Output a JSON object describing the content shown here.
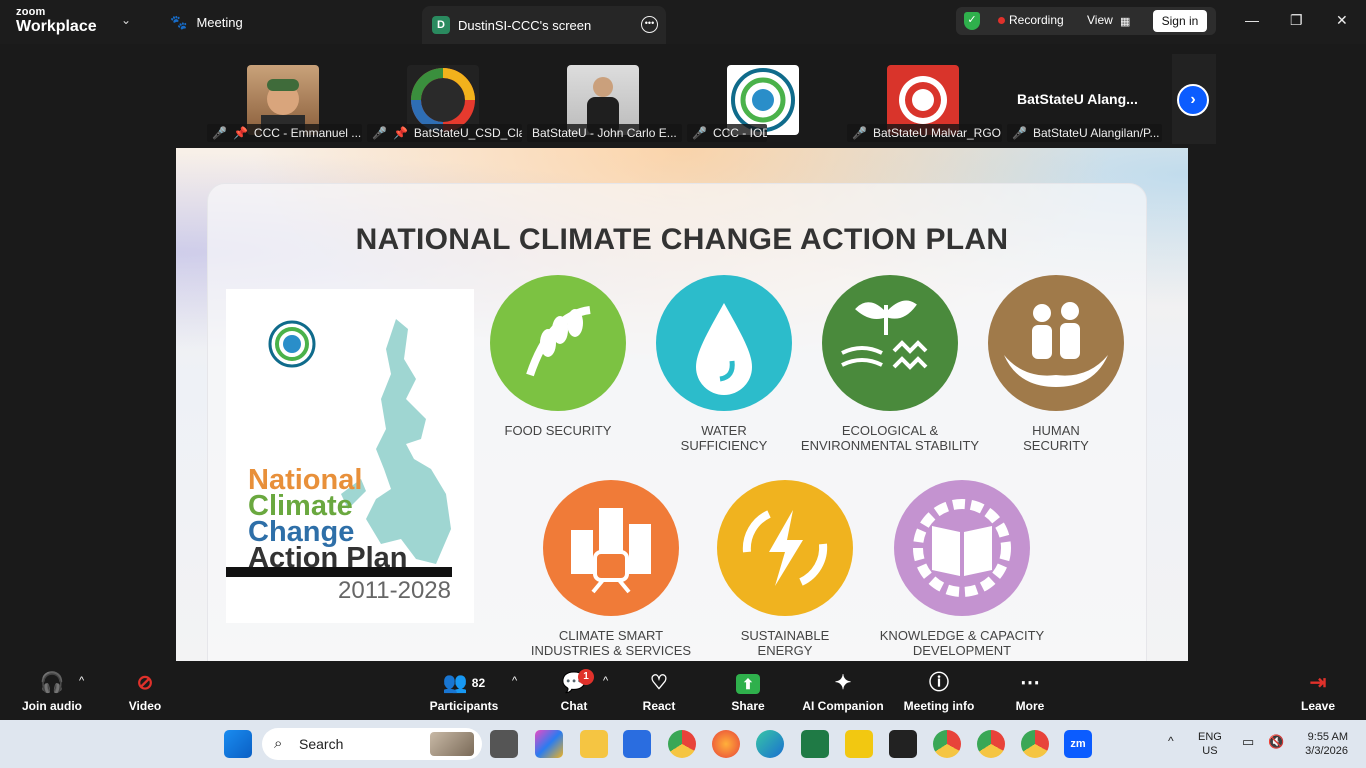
{
  "app": {
    "brand_top": "zoom",
    "brand_bottom": "Workplace"
  },
  "header": {
    "meeting_label": "Meeting",
    "screen_tab_initial": "D",
    "screen_tab_label": "DustinSI-CCC's screen",
    "recording_label": "Recording",
    "view_label": "View",
    "signin_label": "Sign in"
  },
  "participants_strip": [
    {
      "name": "CCC - Emmanuel ...",
      "muted": true,
      "pinned": true
    },
    {
      "name": "BatStateU_CSD_Cla...",
      "muted": true,
      "pinned": true
    },
    {
      "name": "BatStateU - John Carlo E...",
      "muted": false,
      "pinned": false
    },
    {
      "name": "CCC - IOD",
      "muted": true,
      "pinned": false
    },
    {
      "name": "BatStateU Malvar_RGO",
      "muted": true,
      "pinned": false
    },
    {
      "name": "BatStateU Alangilan/P...",
      "muted": true,
      "pinned": false
    }
  ],
  "name_only_tile": "BatStateU  Alang...",
  "slide": {
    "title": "NATIONAL CLIMATE CHANGE ACTION PLAN",
    "cover_lines": [
      "National",
      "Climate",
      "Change",
      "Action Plan"
    ],
    "cover_years": "2011-2028",
    "pillars": [
      {
        "label": "FOOD SECURITY",
        "color": "#7cc242",
        "icon": "rice-icon"
      },
      {
        "label": "WATER\nSUFFICIENCY",
        "color": "#2cbccb",
        "icon": "water-drop-icon"
      },
      {
        "label": "ECOLOGICAL &\nENVIRONMENTAL STABILITY",
        "color": "#4a8a3c",
        "icon": "sprout-wind-icon"
      },
      {
        "label": "HUMAN\nSECURITY",
        "color": "#a07a4a",
        "icon": "family-hands-icon"
      },
      {
        "label": "CLIMATE SMART\nINDUSTRIES & SERVICES",
        "color": "#f07b38",
        "icon": "city-train-icon"
      },
      {
        "label": "SUSTAINABLE\nENERGY",
        "color": "#f0b31f",
        "icon": "lightning-cycle-icon"
      },
      {
        "label": "KNOWLEDGE & CAPACITY\nDEVELOPMENT",
        "color": "#c493d0",
        "icon": "book-gear-icon"
      }
    ]
  },
  "toolbar": {
    "join_audio": "Join audio",
    "video": "Video",
    "participants": "Participants",
    "participants_count": "82",
    "chat": "Chat",
    "chat_badge": "1",
    "react": "React",
    "share": "Share",
    "ai_companion": "AI Companion",
    "meeting_info": "Meeting info",
    "more": "More",
    "leave": "Leave"
  },
  "taskbar": {
    "search_placeholder": "Search",
    "lang_top": "ENG",
    "lang_bottom": "US",
    "time": "9:55 AM",
    "date": "3/3/2026"
  }
}
